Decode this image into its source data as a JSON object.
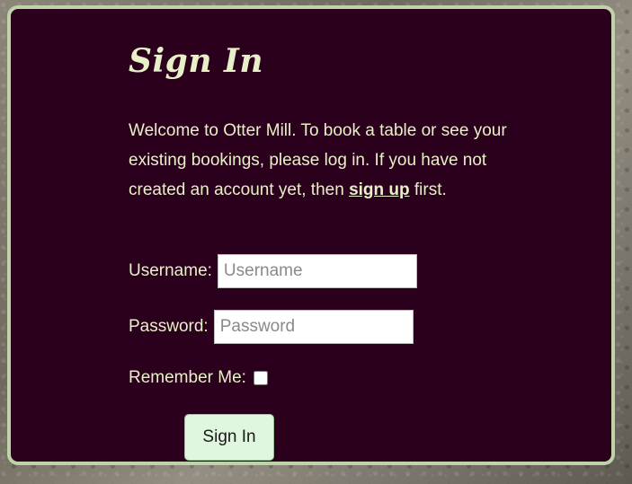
{
  "page": {
    "title": "Sign In",
    "intro_text_before_link": "Welcome to Otter Mill. To book a table or see your existing bookings, please log in. If you have not created an account yet, then ",
    "signup_link_text": "sign up",
    "intro_text_after_link": " first."
  },
  "form": {
    "username_label": "Username:",
    "username_placeholder": "Username",
    "username_value": "",
    "password_label": "Password:",
    "password_placeholder": "Password",
    "password_value": "",
    "remember_label": "Remember Me:",
    "remember_checked": false,
    "submit_label": "Sign In"
  },
  "colors": {
    "card_background": "#2a001c",
    "card_border": "#bfd3a8",
    "text": "#e8f0c8",
    "button_background": "#dff7df"
  }
}
